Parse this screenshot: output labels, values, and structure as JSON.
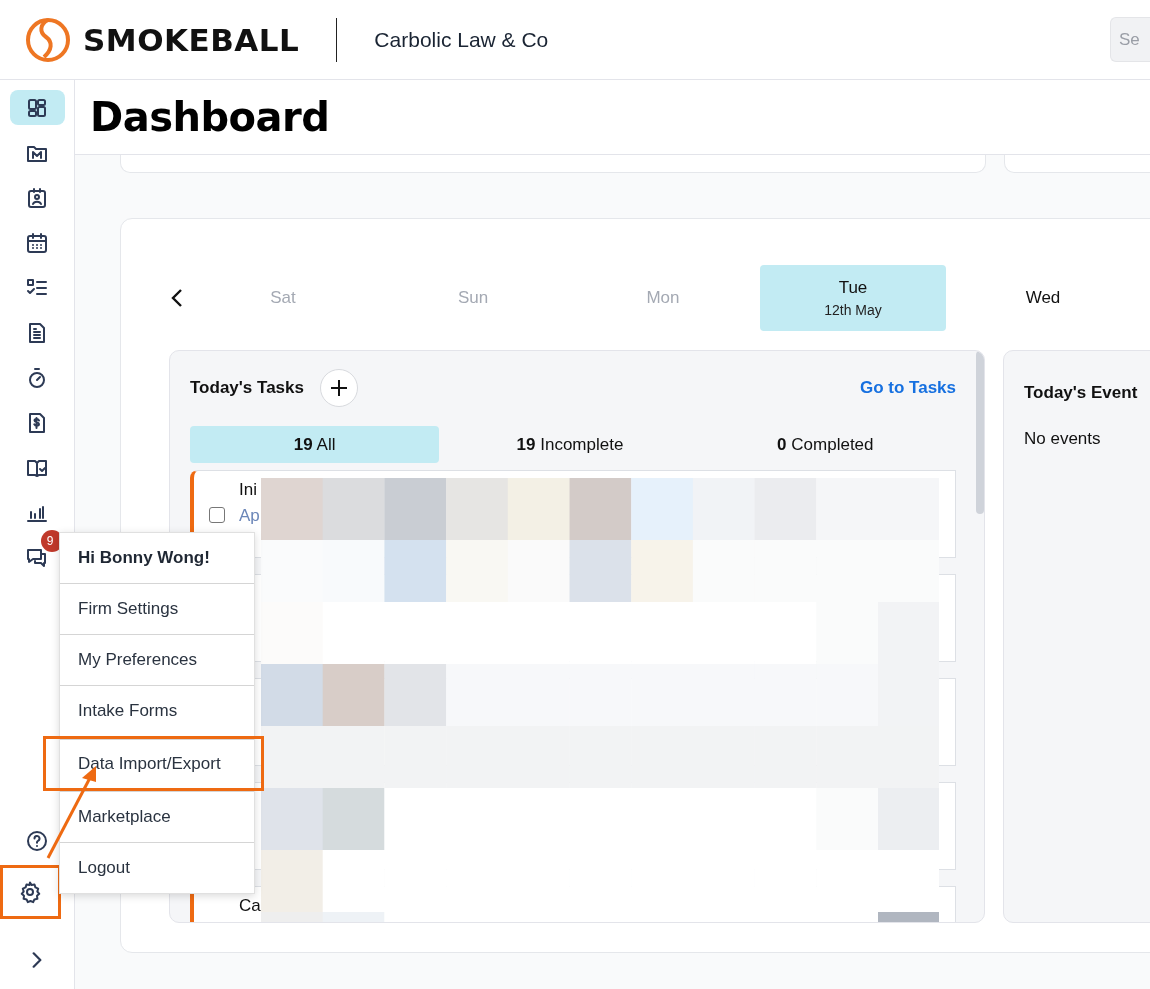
{
  "header": {
    "logo": "SMOKEBALL",
    "firm": "Carbolic Law & Co",
    "search": {
      "placeholder": "Se"
    }
  },
  "sidebar": {
    "items": [
      {
        "kind": "dashboard",
        "selected": true
      },
      {
        "kind": "matters",
        "selected": false
      },
      {
        "kind": "contacts",
        "selected": false
      },
      {
        "kind": "calendar",
        "selected": false
      },
      {
        "kind": "tasks",
        "selected": false
      },
      {
        "kind": "documents",
        "selected": false
      },
      {
        "kind": "timer",
        "selected": false
      },
      {
        "kind": "billing",
        "selected": false
      },
      {
        "kind": "library",
        "selected": false
      },
      {
        "kind": "reports",
        "selected": false
      },
      {
        "kind": "messages",
        "selected": false,
        "badge": "9"
      }
    ],
    "bottom": [
      {
        "kind": "help",
        "highlighted": false
      },
      {
        "kind": "settings",
        "highlighted": true
      },
      {
        "kind": "expand",
        "highlighted": false
      }
    ]
  },
  "page_title": "Dashboard",
  "calendar": {
    "days": [
      {
        "day": "Sat",
        "past": true,
        "selected": false
      },
      {
        "day": "Sun",
        "past": true,
        "selected": false
      },
      {
        "day": "Mon",
        "past": true,
        "selected": false
      },
      {
        "day": "Tue",
        "date": "12th May",
        "past": false,
        "selected": true
      },
      {
        "day": "Wed",
        "past": false,
        "selected": false
      }
    ]
  },
  "tasks": {
    "title": "Today's Tasks",
    "link": "Go to Tasks",
    "filters": [
      {
        "count": "19",
        "label": "All",
        "selected": true
      },
      {
        "count": "19",
        "label": "Incomplete",
        "selected": false
      },
      {
        "count": "0",
        "label": "Completed",
        "selected": false
      }
    ],
    "rows": [
      {
        "title": "Ini",
        "subtitle": "Ap",
        "checked": false
      },
      {},
      {},
      {},
      {
        "title": "Ca"
      }
    ]
  },
  "events": {
    "title": "Today's Event",
    "empty": "No events"
  },
  "user_menu": {
    "greeting": "Hi Bonny Wong!",
    "items": [
      {
        "label": "Firm Settings",
        "highlighted": false
      },
      {
        "label": "My Preferences",
        "highlighted": false
      },
      {
        "label": "Intake Forms",
        "highlighted": false
      },
      {
        "label": "Data Import/Export",
        "highlighted": true
      },
      {
        "label": "Marketplace",
        "highlighted": false
      },
      {
        "label": "Logout",
        "highlighted": false
      }
    ]
  }
}
